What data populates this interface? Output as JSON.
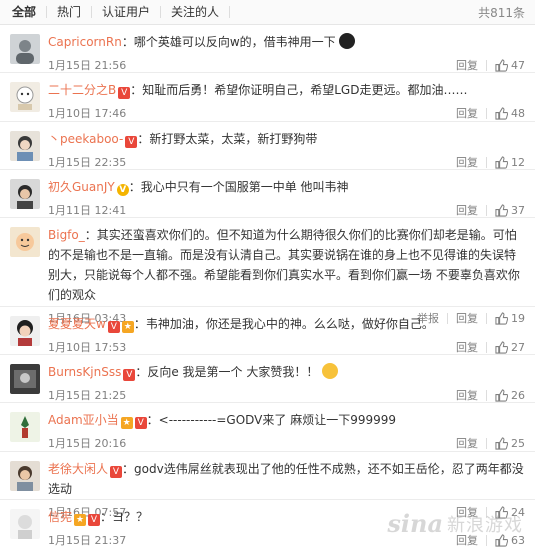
{
  "tabs": {
    "all": "全部",
    "hot": "热门",
    "verified": "认证用户",
    "following": "关注的人",
    "total": "共811条"
  },
  "actions": {
    "reply": "回复",
    "report": "举报"
  },
  "comments": [
    {
      "user": "CapricornRn",
      "text": "：哪个英雄可以反向w的，借韦神用一下",
      "time": "1月15日 21:56",
      "likes": "47",
      "emoji": "black-face"
    },
    {
      "user": "二十二分之B",
      "text": "：知耻而后勇！希望你证明自己，希望LGD走更远。都加油……",
      "time": "1月10日 17:46",
      "likes": "48"
    },
    {
      "user": "丶peekaboo-",
      "text": "：新打野太菜，太菜，新打野狗带",
      "time": "1月15日 22:35",
      "likes": "12"
    },
    {
      "user": "初久GuanJY",
      "text": "：我心中只有一个国服第一中单 他叫韦神",
      "time": "1月11日 12:41",
      "likes": "37"
    },
    {
      "user": "Bigfo_",
      "text": "：其实还蛮喜欢你们的。但不知道为什么期待很久你们的比赛你们却老是输。可怕的不是输也不是一直输。而是没有认清自己。其实要说锅在谁的身上也不见得谁的失误特别大，只能说每个人都不强。希望能看到你们真实水平。看到你们赢一场 不要辜负喜欢你们的观众",
      "time": "1月16日 03:43",
      "likes": "19"
    },
    {
      "user": "夏夏夏天w",
      "text": "：韦神加油，你还是我心中的神。么么哒，做好你自己。",
      "time": "1月10日 17:53",
      "likes": "27"
    },
    {
      "user": "BurnsKjnSss",
      "text": "：反向e 我是第一个 大家赞我！！",
      "time": "1月15日 21:25",
      "likes": "26",
      "emoji": "laugh"
    },
    {
      "user": "Adam亚小当",
      "text": "：<-----------=GODV来了 麻烦让一下999999",
      "time": "1月15日 20:16",
      "likes": "25"
    },
    {
      "user": "老徐大闲人",
      "text": "：godv选伟屌丝就表现出了他的任性不成熟，还不如王岳伦，忍了两年都没选动",
      "time": "1月16日 07:57",
      "likes": "24"
    },
    {
      "user": "信宪",
      "text": "：ヨ？？",
      "time": "1月15日 21:37",
      "likes": "63"
    }
  ],
  "watermark": {
    "brand": "sina",
    "text": "新浪游戏"
  }
}
